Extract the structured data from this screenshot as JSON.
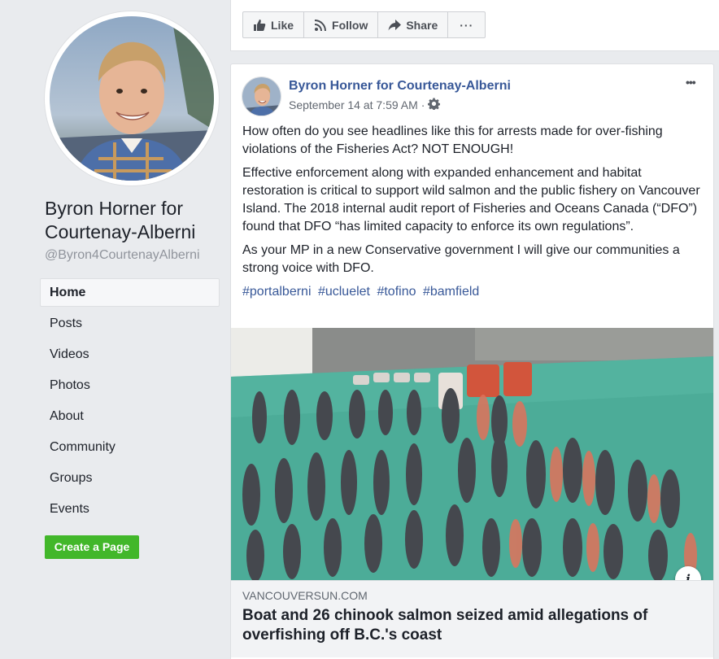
{
  "page": {
    "name": "Byron Horner for Courtenay-Alberni",
    "handle": "@Byron4CourtenayAlberni"
  },
  "nav": {
    "items": [
      {
        "label": "Home"
      },
      {
        "label": "Posts"
      },
      {
        "label": "Videos"
      },
      {
        "label": "Photos"
      },
      {
        "label": "About"
      },
      {
        "label": "Community"
      },
      {
        "label": "Groups"
      },
      {
        "label": "Events"
      }
    ],
    "active": "Home"
  },
  "create_page_label": "Create a Page",
  "actions": {
    "like": "Like",
    "follow": "Follow",
    "share": "Share",
    "more": "···"
  },
  "post": {
    "author": "Byron Horner for Courtenay-Alberni",
    "timestamp": "September 14 at 7:59 AM",
    "separator": "·",
    "paragraphs": [
      "How often do you see headlines like this for arrests made for over-fishing violations of the Fisheries Act? NOT ENOUGH!",
      "Effective enforcement along with expanded enhancement and habitat restoration is critical to support wild salmon and the public fishery on Vancouver Island. The 2018 internal audit report of Fisheries and Oceans Canada (“DFO”) found that DFO “has limited capacity to enforce its own regulations”.",
      "As your MP in a new Conservative government I will give our communities a strong voice with DFO."
    ],
    "hashtags": [
      "#portalberni",
      "#ucluelet",
      "#tofino",
      "#bamfield"
    ],
    "more_menu": "•••",
    "link": {
      "domain": "VANCOUVERSUN.COM",
      "title": "Boat and 26 chinook salmon seized amid allegations of overfishing off B.C.'s coast",
      "info": "i"
    }
  },
  "colors": {
    "link_blue": "#385898",
    "create_green": "#42b72a",
    "background": "#e9ebee"
  },
  "icons": [
    "like-icon",
    "follow-icon",
    "share-icon",
    "gear-icon",
    "more-icon",
    "info-icon"
  ]
}
